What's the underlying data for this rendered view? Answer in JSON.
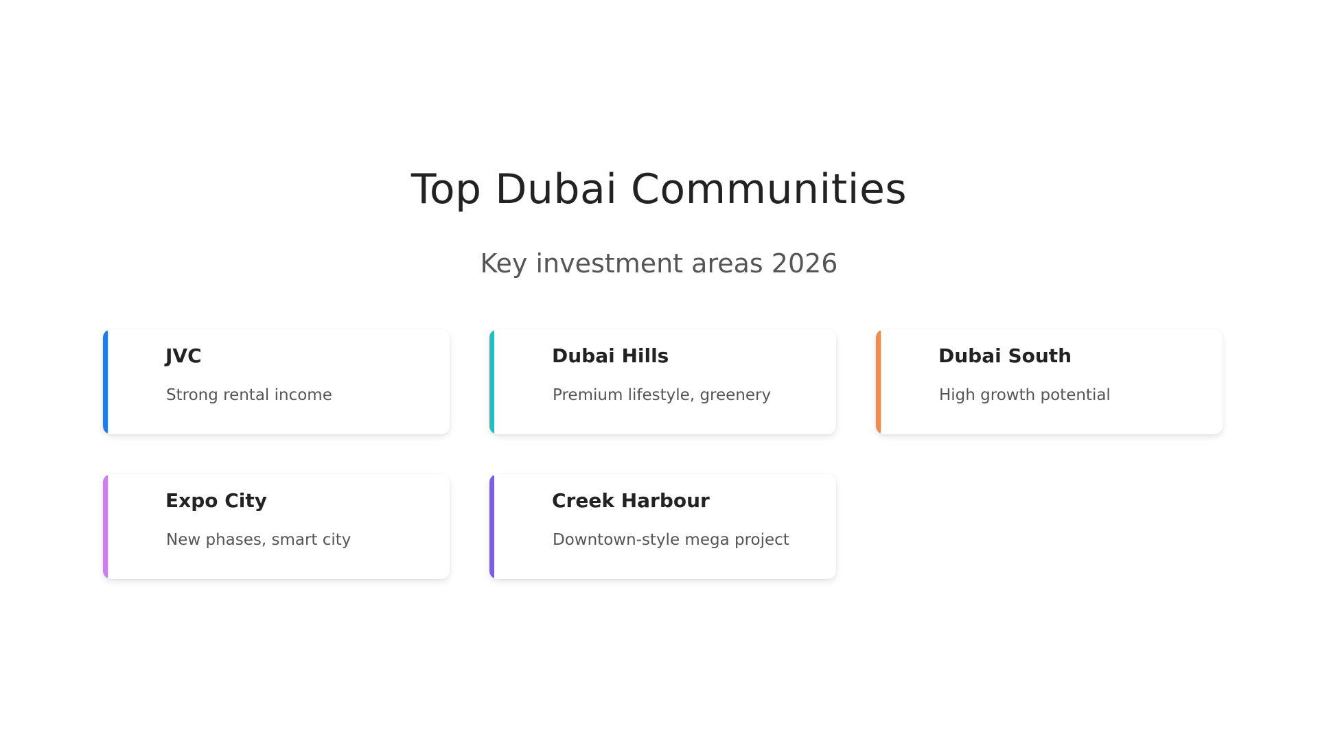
{
  "header": {
    "title": "Top Dubai Communities",
    "subtitle": "Key investment areas 2026"
  },
  "cards": [
    {
      "title": "JVC",
      "description": "Strong rental income",
      "accent_color": "#1e7cf2"
    },
    {
      "title": "Dubai Hills",
      "description": "Premium lifestyle, greenery",
      "accent_color": "#17c3c3"
    },
    {
      "title": "Dubai South",
      "description": "High growth potential",
      "accent_color": "#f08a50"
    },
    {
      "title": "Expo City",
      "description": "New phases, smart city",
      "accent_color": "#d07cf0"
    },
    {
      "title": "Creek Harbour",
      "description": "Downtown-style mega project",
      "accent_color": "#7a5cf0"
    }
  ]
}
